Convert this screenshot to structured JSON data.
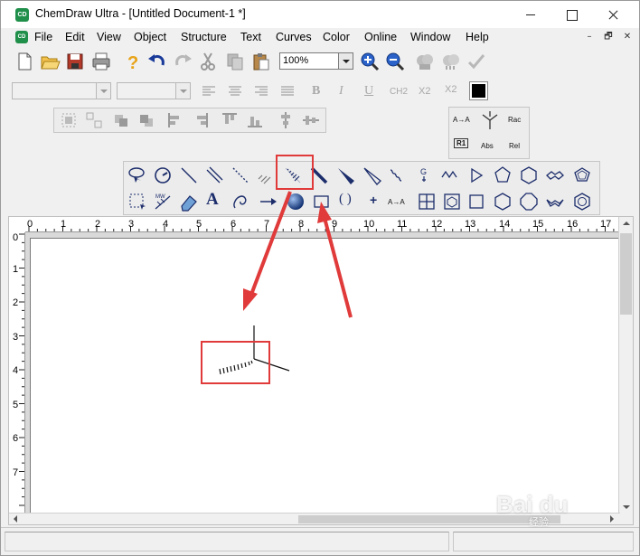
{
  "window": {
    "app_icon_text": "CD",
    "title": "ChemDraw Ultra - [Untitled Document-1 *]"
  },
  "menubar": {
    "items": [
      {
        "label": "File",
        "name": "menu-file"
      },
      {
        "label": "Edit",
        "name": "menu-edit"
      },
      {
        "label": "View",
        "name": "menu-view"
      },
      {
        "label": "Object",
        "name": "menu-object"
      },
      {
        "label": "Structure",
        "name": "menu-structure"
      },
      {
        "label": "Text",
        "name": "menu-text"
      },
      {
        "label": "Curves",
        "name": "menu-curves"
      },
      {
        "label": "Color",
        "name": "menu-color"
      },
      {
        "label": "Online",
        "name": "menu-online"
      },
      {
        "label": "Window",
        "name": "menu-window"
      },
      {
        "label": "Help",
        "name": "menu-help"
      }
    ],
    "mdi_minimize": "–",
    "mdi_restore": "🗗",
    "mdi_close": "✕"
  },
  "toolbar": {
    "zoom_value": "100%",
    "style_buttons": {
      "bold": "B",
      "italic": "I",
      "underline": "U",
      "formula": "CH2",
      "subscript": "X2",
      "superscript": "X2"
    },
    "current_color": "#000000"
  },
  "stereo_palette": {
    "flip_label": "A→A",
    "racemic": "Rac",
    "r1_label": "R1",
    "absolute": "Abs",
    "relative": "Rel"
  },
  "main_palette": {
    "text_tool": "A",
    "mass_label": "MW",
    "reaction_label": "A→A",
    "plus_label": "+",
    "brackets_label": "( )"
  },
  "rulers": {
    "horizontal": [
      "0",
      "1",
      "2",
      "3",
      "4",
      "5",
      "6",
      "7",
      "8",
      "9",
      "10",
      "11",
      "12",
      "13",
      "14",
      "15",
      "16",
      "17"
    ],
    "vertical": [
      "0",
      "1",
      "2",
      "3",
      "4",
      "5",
      "6",
      "7"
    ]
  },
  "watermark": {
    "brand": "Bai du",
    "sub": "经验"
  },
  "colors": {
    "accent": "#e03a3a",
    "app_green": "#1f8f4a",
    "tool_blue": "#1c2d6b"
  }
}
